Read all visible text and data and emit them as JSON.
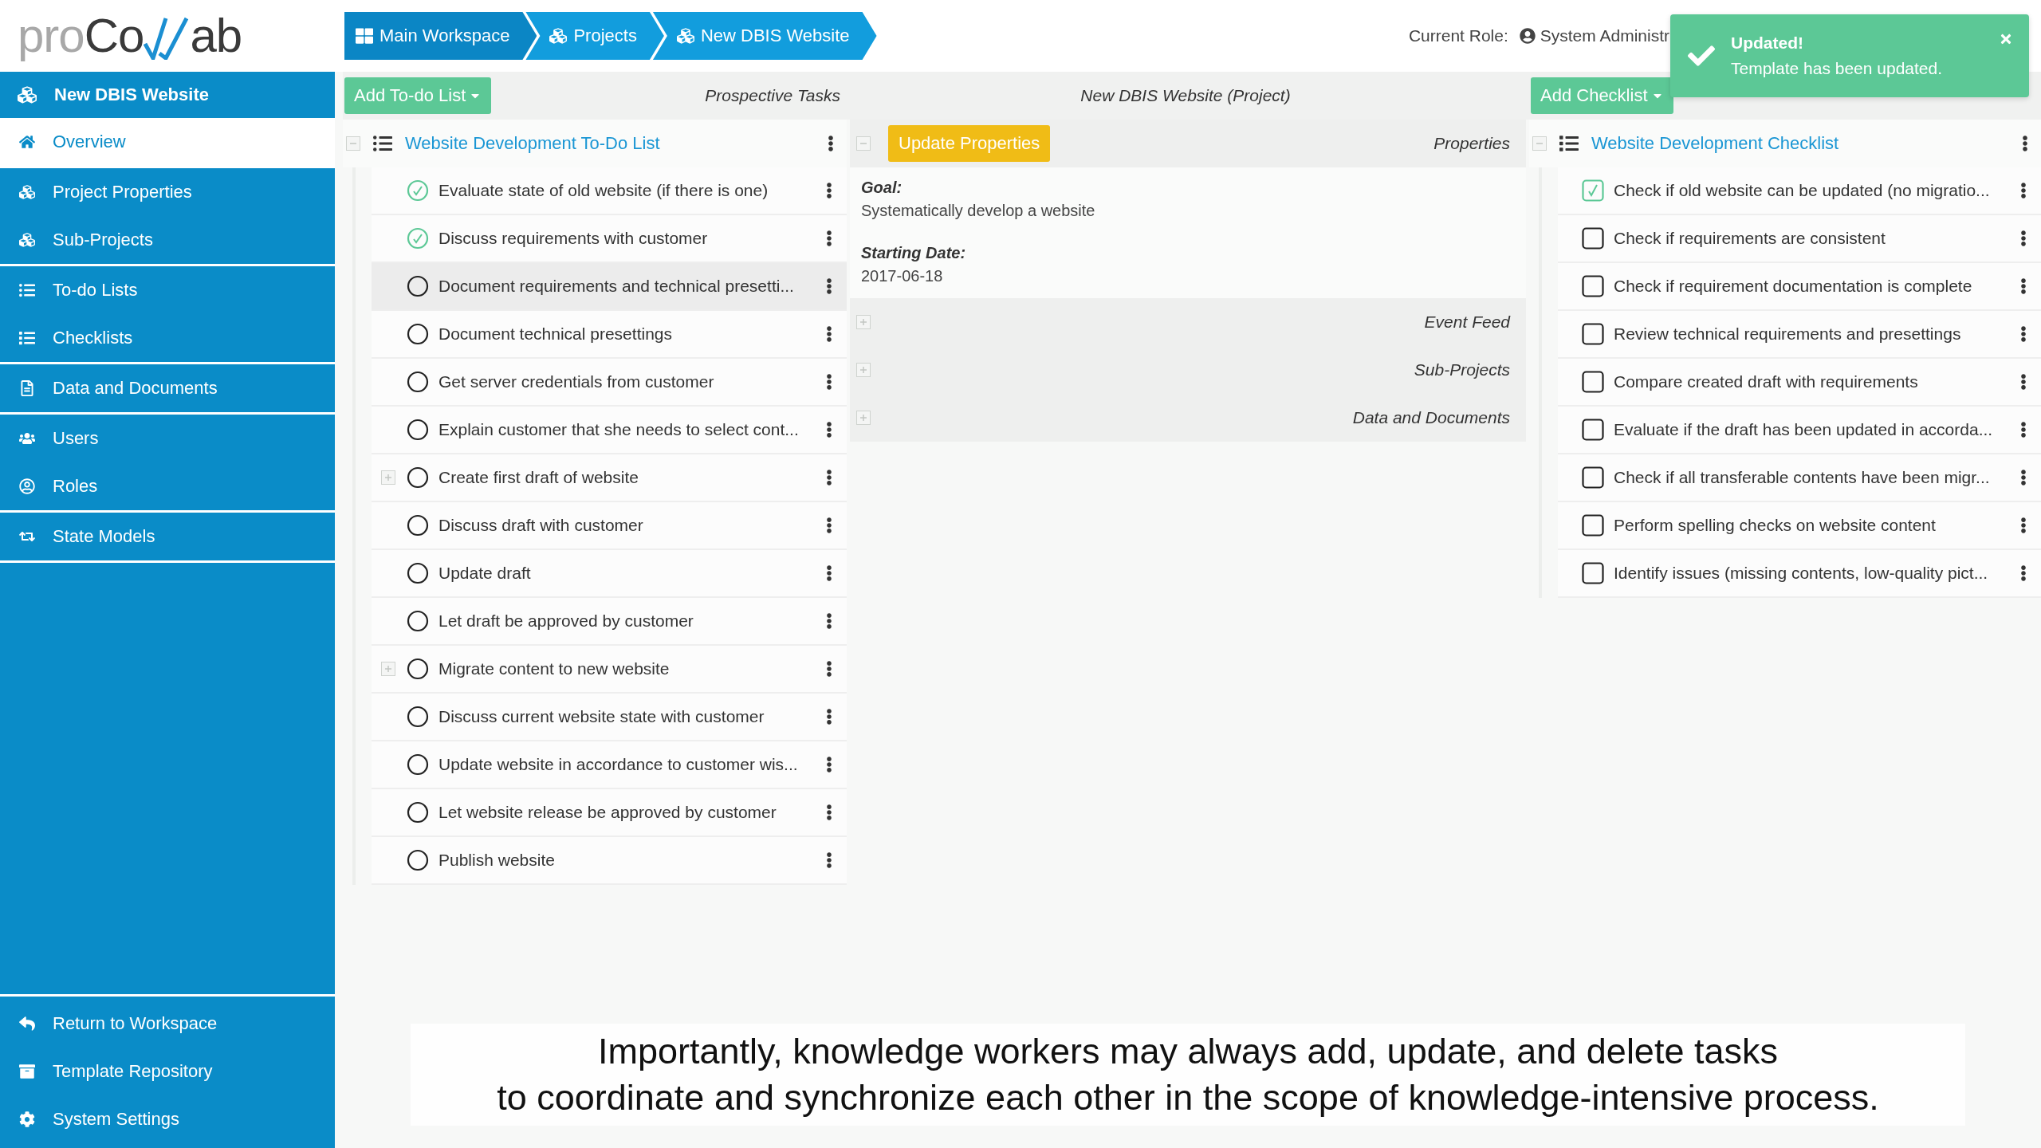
{
  "logo": {
    "prefix": "pro",
    "middle": "Co",
    "suffix": "ab"
  },
  "breadcrumb": [
    {
      "label": "Main Workspace"
    },
    {
      "label": "Projects"
    },
    {
      "label": "New DBIS Website"
    }
  ],
  "role": {
    "label": "Current Role:",
    "value": "System Administr"
  },
  "toast": {
    "title": "Updated!",
    "message": "Template has been updated."
  },
  "sidebar": {
    "header": "New DBIS Website",
    "groups": [
      [
        {
          "label": "Overview",
          "selected": true
        }
      ],
      [
        {
          "label": "Project Properties",
          "selected": false
        },
        {
          "label": "Sub-Projects",
          "selected": false
        }
      ],
      [
        {
          "label": "To-do Lists",
          "selected": false
        },
        {
          "label": "Checklists",
          "selected": false
        }
      ],
      [
        {
          "label": "Data and Documents",
          "selected": false
        }
      ],
      [
        {
          "label": "Users",
          "selected": false
        },
        {
          "label": "Roles",
          "selected": false
        }
      ],
      [
        {
          "label": "State Models",
          "selected": false
        }
      ]
    ],
    "footer": [
      {
        "label": "Return to Workspace"
      },
      {
        "label": "Template Repository"
      },
      {
        "label": "System Settings"
      }
    ]
  },
  "todo": {
    "button": "Add To-do List",
    "heading": "Prospective Tasks",
    "list": {
      "title": "Website Development To-Do List",
      "expanded": true,
      "items": [
        {
          "label": "Evaluate state of old website (if there is one)",
          "done": true,
          "has_children": false,
          "selected": false
        },
        {
          "label": "Discuss requirements with customer",
          "done": true,
          "has_children": false,
          "selected": false
        },
        {
          "label": "Document requirements and technical presetti...",
          "done": false,
          "has_children": false,
          "selected": true
        },
        {
          "label": "Document technical presettings",
          "done": false,
          "has_children": false,
          "selected": false
        },
        {
          "label": "Get server credentials from customer",
          "done": false,
          "has_children": false,
          "selected": false
        },
        {
          "label": "Explain customer that she needs to select cont...",
          "done": false,
          "has_children": false,
          "selected": false
        },
        {
          "label": "Create first draft of website",
          "done": false,
          "has_children": true,
          "selected": false
        },
        {
          "label": "Discuss draft with customer",
          "done": false,
          "has_children": false,
          "selected": false
        },
        {
          "label": "Update draft",
          "done": false,
          "has_children": false,
          "selected": false
        },
        {
          "label": "Let draft be approved by customer",
          "done": false,
          "has_children": false,
          "selected": false
        },
        {
          "label": "Migrate content to new website",
          "done": false,
          "has_children": true,
          "selected": false
        },
        {
          "label": "Discuss current website state with customer",
          "done": false,
          "has_children": false,
          "selected": false
        },
        {
          "label": "Update website in accordance to customer wis...",
          "done": false,
          "has_children": false,
          "selected": false
        },
        {
          "label": "Let website release be approved by customer",
          "done": false,
          "has_children": false,
          "selected": false
        },
        {
          "label": "Publish website",
          "done": false,
          "has_children": false,
          "selected": false
        }
      ]
    }
  },
  "project": {
    "heading": "New DBIS Website (Project)",
    "sections": [
      {
        "kind": "properties",
        "title": "Properties",
        "button": "Update Properties",
        "expanded": true,
        "fields": [
          {
            "label": "Goal:",
            "value": "Systematically develop a website"
          },
          {
            "label": "Starting Date:",
            "value": "2017-06-18"
          }
        ]
      },
      {
        "kind": "plain",
        "title": "Event Feed",
        "expanded": false
      },
      {
        "kind": "plain",
        "title": "Sub-Projects",
        "expanded": false
      },
      {
        "kind": "plain",
        "title": "Data and Documents",
        "expanded": false
      }
    ]
  },
  "checklist": {
    "button": "Add Checklist",
    "list": {
      "title": "Website Development Checklist",
      "expanded": true,
      "items": [
        {
          "label": "Check if old website can be updated (no migratio...",
          "checked": true
        },
        {
          "label": "Check if requirements are consistent",
          "checked": false
        },
        {
          "label": "Check if requirement documentation is complete",
          "checked": false
        },
        {
          "label": "Review technical requirements and presettings",
          "checked": false
        },
        {
          "label": "Compare created draft with requirements",
          "checked": false
        },
        {
          "label": "Evaluate if the draft has been updated in accorda...",
          "checked": false
        },
        {
          "label": "Check if all transferable contents have been migr...",
          "checked": false
        },
        {
          "label": "Perform spelling checks on website content",
          "checked": false
        },
        {
          "label": "Identify issues (missing contents, low-quality pict...",
          "checked": false
        }
      ]
    }
  },
  "caption": {
    "lines": [
      "Importantly, knowledge workers may always add, update, and delete tasks",
      "to coordinate and synchronize each other in the scope of knowledge-intensive process."
    ]
  }
}
